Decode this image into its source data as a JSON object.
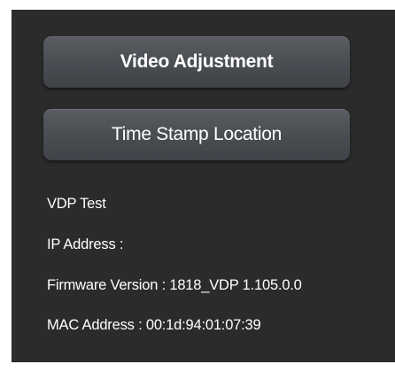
{
  "buttons": {
    "video_adjustment": "Video Adjustment",
    "time_stamp_location": "Time Stamp Location"
  },
  "info": {
    "vdp_test": "VDP Test",
    "ip_address_label": "IP Address :",
    "firmware_label": "Firmware Version",
    "firmware_value": "1818_VDP 1.105.0.0",
    "mac_label": "MAC Address",
    "mac_value": "00:1d:94:01:07:39",
    "separator": ":"
  }
}
